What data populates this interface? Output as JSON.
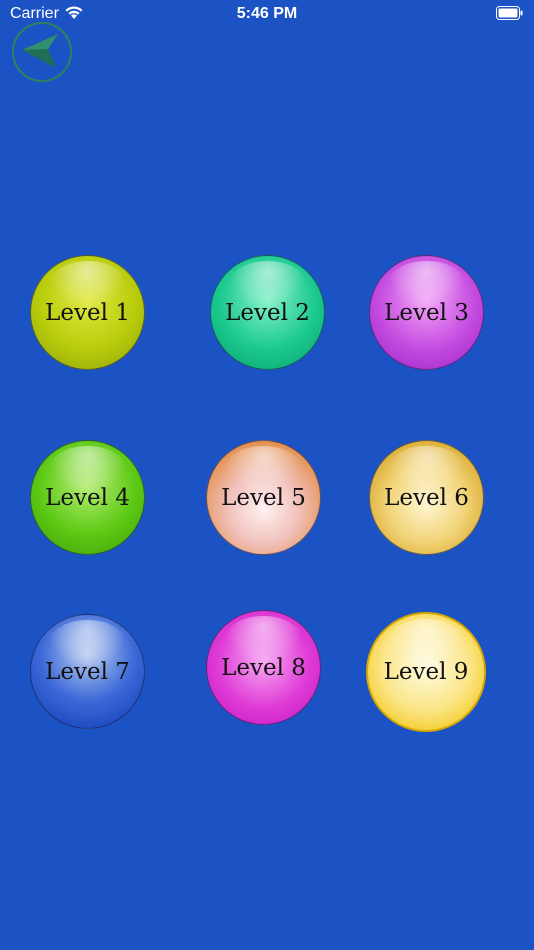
{
  "status_bar": {
    "carrier": "Carrier",
    "time": "5:46 PM"
  },
  "back_button": {
    "icon": "arrow-left-icon",
    "color": "#2f8060"
  },
  "levels": [
    {
      "label": "Level 1",
      "color": "#b8cc0c"
    },
    {
      "label": "Level 2",
      "color": "#1bc98f"
    },
    {
      "label": "Level 3",
      "color": "#c44be0"
    },
    {
      "label": "Level 4",
      "color": "#5cc914"
    },
    {
      "label": "Level 5",
      "color": "#e49253"
    },
    {
      "label": "Level 6",
      "color": "#d9a92b"
    },
    {
      "label": "Level 7",
      "color": "#0b37b5"
    },
    {
      "label": "Level 8",
      "color": "#df3bd6"
    },
    {
      "label": "Level 9",
      "color": "#f3c81d"
    }
  ],
  "background_color": "#1c53c4"
}
